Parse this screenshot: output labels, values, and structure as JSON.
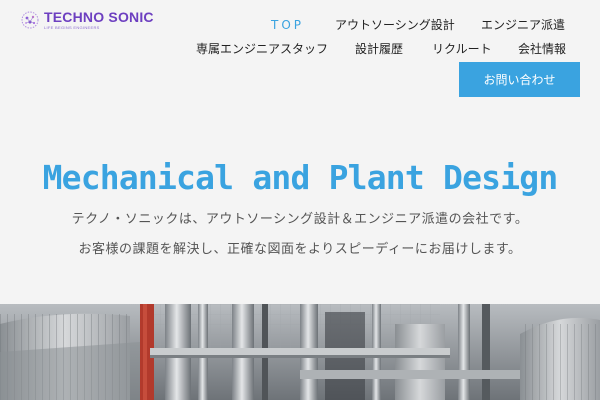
{
  "logo": {
    "name": "TECHNO SONIC",
    "tagline": "LIFE BEGINS ENGINEERS"
  },
  "nav": {
    "top": "TOP",
    "outsourcing": "アウトソーシング設計",
    "dispatch": "エンジニア派遣",
    "staff": "専属エンジニアスタッフ",
    "history": "設計履歴",
    "recruit": "リクルート",
    "company": "会社情報",
    "contact": "お問い合わせ"
  },
  "hero": {
    "title": "Mechanical and Plant Design",
    "line1": "テクノ・ソニックは、アウトソーシング設計＆エンジニア派遣の会社です。",
    "line2": "お客様の課題を解決し、正確な図面をよりスピーディーにお届けします。"
  },
  "colors": {
    "accent": "#3aa3e0",
    "brand": "#6d3fc0",
    "background": "#f4f4f4"
  },
  "icons": {
    "logo": "brain-logo-icon"
  }
}
